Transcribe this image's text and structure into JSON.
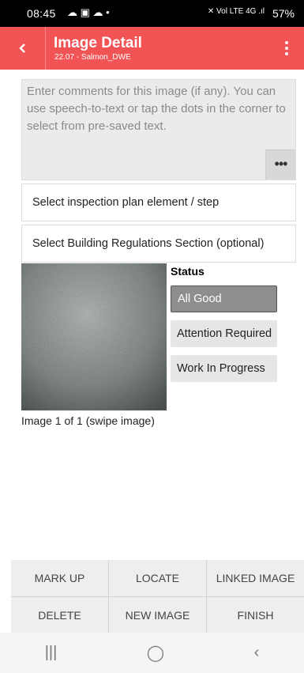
{
  "status_bar": {
    "time": "08:45",
    "left_icons": "☁ ▣ ☁ •",
    "right_icons": "✕ Vol LTE 4G .ıl",
    "battery": "57%"
  },
  "header": {
    "title": "Image Detail",
    "subtitle": "22.07 - Salmon_DWE",
    "back_icon": "chevron-left",
    "menu_icon": "vertical-dots"
  },
  "comments": {
    "placeholder": "Enter comments for this image (if any). You can use speech-to-text or tap the dots in the corner to select from pre-saved text.",
    "dots_label": "•••"
  },
  "selectors": {
    "plan_element": "Select inspection plan element / step",
    "regulations": "Select Building Regulations Section (optional)"
  },
  "status": {
    "label": "Status",
    "options": [
      "All Good",
      "Attention Required",
      "Work In Progress"
    ],
    "selected": "All Good"
  },
  "image": {
    "caption": "Image 1 of 1 (swipe image)"
  },
  "actions": {
    "row1": [
      "MARK UP",
      "LOCATE",
      "LINKED IMAGE"
    ],
    "row2": [
      "DELETE",
      "NEW IMAGE",
      "FINISH"
    ]
  },
  "nav": {
    "recents": "|||",
    "home": "◯",
    "back": "‹"
  },
  "colors": {
    "header": "#f25456",
    "selected_status": "#8e8e8e"
  }
}
